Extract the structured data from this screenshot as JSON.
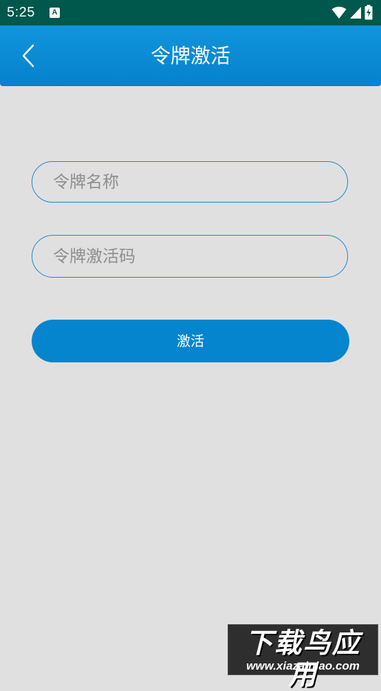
{
  "status_bar": {
    "time": "5:25",
    "notification_icon_letter": "A",
    "icons": [
      "wifi-icon",
      "signal-icon",
      "battery-charging-icon"
    ]
  },
  "app_bar": {
    "title": "令牌激活",
    "back_icon": "chevron-left-icon",
    "background": "#0a8bd3"
  },
  "form": {
    "token_name_placeholder": "令牌名称",
    "token_name_value": "",
    "activation_code_placeholder": "令牌激活码",
    "activation_code_value": "",
    "submit_label": "激活",
    "accent_color": "#0585cd"
  },
  "watermark": {
    "logo_text": "下载鸟应用",
    "url": "www.xiazainiao.com"
  }
}
